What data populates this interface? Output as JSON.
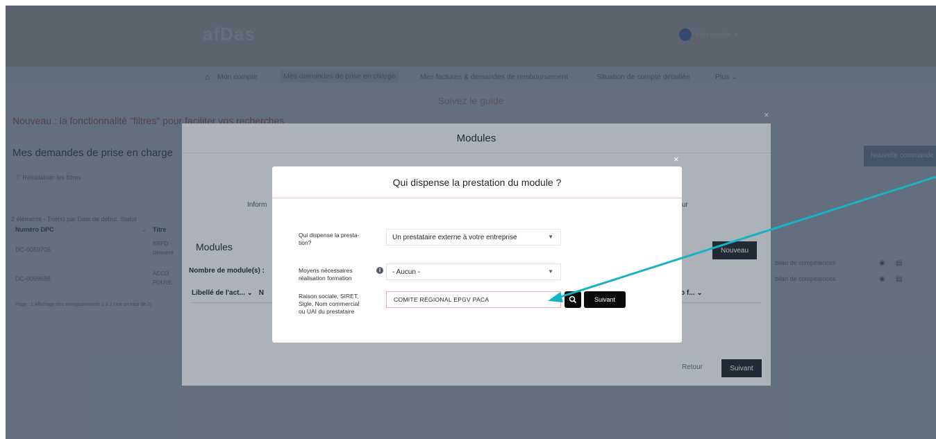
{
  "background_page": {
    "logo": "afDas",
    "user_label": "Mon compte",
    "nav": {
      "items": [
        "Mon compte",
        "Mes demandes de prise en charge",
        "Mes factures & demandes de remboursement",
        "Situation de compte détaillée",
        "Plus ⌄"
      ],
      "active_index": 1
    },
    "guide_link": "Suivez le guide",
    "announcement": "Nouveau : la fonctionnalité \"filtres\" pour faciliter vos recherches",
    "page_title": "Mes demandes de prise en charge",
    "new_command_button": "Nouvelle commande",
    "reset_filters": "Réinitialiser les filtres",
    "sort_info": "2 éléments - Trié(s) par Date de début, Statut",
    "table": {
      "headers": [
        "Numéro DPC",
        "Titre"
      ],
      "rows": [
        {
          "number": "DC-0059705",
          "title": "BRPD - démarré",
          "right": "bilan de compétences"
        },
        {
          "number": "DC-0059686",
          "title": "ACCO POUVE",
          "right": "bilan de compétences"
        }
      ]
    },
    "paging": "Page : 1 Affichage des enregistrements 1 à 2 (sur un total de 2)"
  },
  "modules_modal": {
    "title": "Modules",
    "info_text": "Inform",
    "info_end": "ur",
    "section_title": "Modules",
    "new_button": "Nouveau",
    "module_count_label": "Nombre de module(s) :",
    "col_libelle": "Libellé de l'act... ⌄",
    "col_n": "N",
    "col_right": "p f... ⌄",
    "back_button": "Retour",
    "next_button": "Suivant"
  },
  "dialog": {
    "title": "Qui dispense la prestation du module ?",
    "fields": {
      "provider_type": {
        "label": "Qui dispense la presta-tion?",
        "value": "Un prestataire externe à votre entreprise"
      },
      "means": {
        "label": "Moyens nécessaires réalisation formation",
        "value": "- Aucun -"
      },
      "provider_search": {
        "label": "Raison sociale, SIRET, Sigle, Nom commercial ou UAI du prestataire",
        "value": "COMITE REGIONAL EPGV PACA"
      }
    },
    "next_button": "Suivant"
  },
  "colors": {
    "topbar": "#ead8d0",
    "arrow": "#17b3c3",
    "input_border": "#eeb3a6",
    "button_dark": "#0b0b0b"
  }
}
